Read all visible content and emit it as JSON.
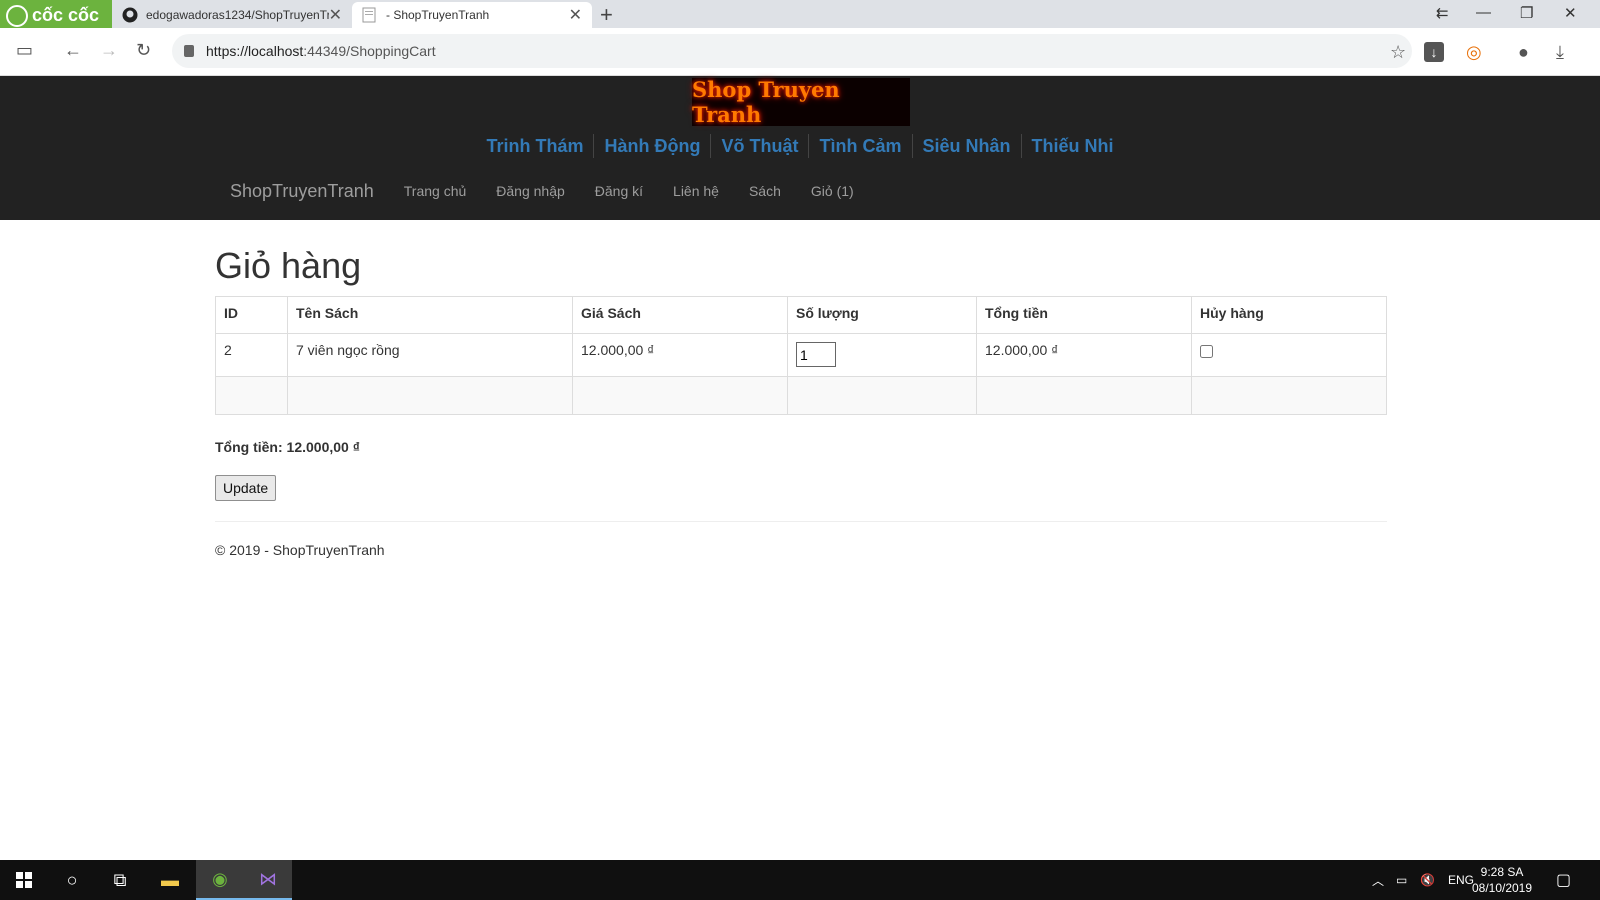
{
  "browser": {
    "brand": "cốc cốc",
    "tabs": [
      {
        "label": "edogawadoras1234/ShopTruyenTr"
      },
      {
        "label": "- ShopTruyenTranh"
      }
    ],
    "url_host": "https://localhost",
    "url_rest": ":44349/ShoppingCart"
  },
  "site": {
    "logo_text": "Shop Truyen Tranh",
    "categories": [
      "Trinh Thám",
      "Hành Động",
      "Võ Thuật",
      "Tình Cảm",
      "Siêu Nhân",
      "Thiếu Nhi"
    ],
    "brand": "ShopTruyenTranh",
    "menu": [
      "Trang chủ",
      "Đăng nhập",
      "Đăng kí",
      "Liên hệ",
      "Sách",
      "Giỏ (1)"
    ]
  },
  "cart": {
    "title": "Giỏ hàng",
    "headers": [
      "ID",
      "Tên Sách",
      "Giá Sách",
      "Số lượng",
      "Tổng tiền",
      "Hủy hàng"
    ],
    "rows": [
      {
        "id": "2",
        "name": "7 viên ngọc rồng",
        "price": "12.000,00 ₫",
        "qty": "1",
        "total": "12.000,00 ₫",
        "remove": false
      }
    ],
    "total_text": "Tổng tiền: 12.000,00 ₫",
    "update_label": "Update",
    "footer": "© 2019 - ShopTruyenTranh"
  },
  "taskbar": {
    "lang": "ENG",
    "time": "9:28 SA",
    "date": "08/10/2019"
  }
}
